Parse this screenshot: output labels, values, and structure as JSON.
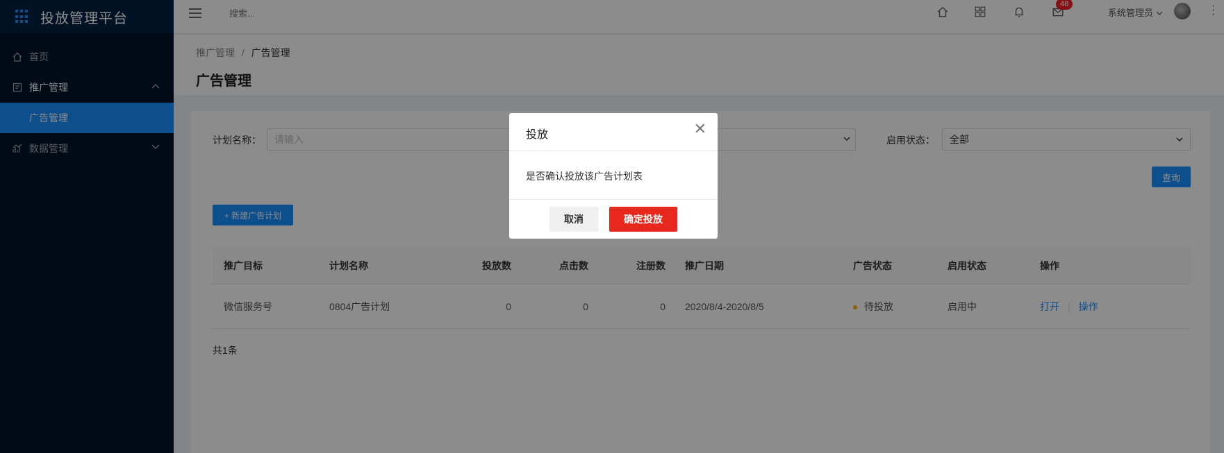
{
  "app": {
    "title": "投放管理平台"
  },
  "sidebar": {
    "items": [
      {
        "label": "首页"
      },
      {
        "label": "推广管理"
      },
      {
        "label": "广告管理"
      },
      {
        "label": "数据管理"
      }
    ]
  },
  "header": {
    "search_placeholder": "搜索...",
    "mail_badge": "48",
    "user_name": "系统管理员"
  },
  "breadcrumb": {
    "parent": "推广管理",
    "separator": "/",
    "current": "广告管理"
  },
  "page_title": "广告管理",
  "filters": {
    "plan_name_label": "计划名称：",
    "plan_name_placeholder": "请输入",
    "enable_status_label": "启用状态：",
    "enable_status_value": "全部",
    "query_button": "查询"
  },
  "new_plan_button": "+ 新建广告计划",
  "table": {
    "headers": [
      "推广目标",
      "计划名称",
      "投放数",
      "点击数",
      "注册数",
      "推广日期",
      "广告状态",
      "启用状态",
      "操作"
    ],
    "rows": [
      {
        "target": "微信服务号",
        "name": "0804广告计划",
        "deliveries": "0",
        "clicks": "0",
        "registrations": "0",
        "date": "2020/8/4-2020/8/5",
        "ad_status": "待投放",
        "enable_status": "启用中",
        "action_open": "打开",
        "action_operate": "操作"
      }
    ],
    "total": "共1条"
  },
  "modal": {
    "title": "投放",
    "message": "是否确认投放该广告计划表",
    "cancel_label": "取消",
    "confirm_label": "确定投放"
  },
  "colors": {
    "primary": "#1890ff",
    "sidebar_bg": "#001529",
    "confirm": "#e8281d",
    "pending_dot": "#faad14"
  }
}
